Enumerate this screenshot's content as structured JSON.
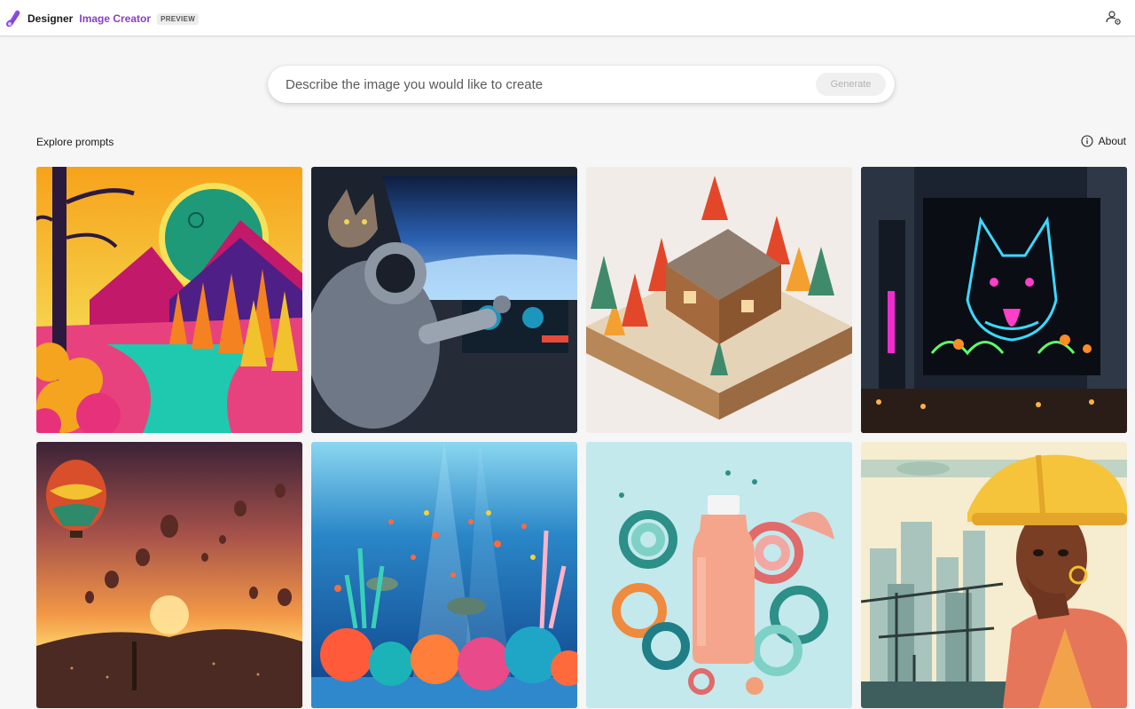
{
  "header": {
    "brand_name": "Designer",
    "product_name": "Image Creator",
    "badge": "PREVIEW",
    "user_icon": "people-settings-icon"
  },
  "search": {
    "placeholder": "Describe the image you would like to create",
    "generate_label": "Generate"
  },
  "explore": {
    "title": "Explore prompts",
    "about_label": "About",
    "about_icon": "info-icon"
  },
  "gallery": [
    {
      "subject": "psychedelic landscape with tree, planet and river"
    },
    {
      "subject": "cat astronaut piloting a spaceship"
    },
    {
      "subject": "isometric autumn cabin diorama"
    },
    {
      "subject": "neon german shepherd sign in a city at night"
    },
    {
      "subject": "hot air balloons over a city at sunset"
    },
    {
      "subject": "underwater coral reef with fish and turtles"
    },
    {
      "subject": "bottle surrounded by paper quilling swirls"
    },
    {
      "subject": "construction worker woman with city skyline illustration"
    }
  ],
  "colors": {
    "accent": "#8a3fc2",
    "background": "#f6f6f6"
  }
}
